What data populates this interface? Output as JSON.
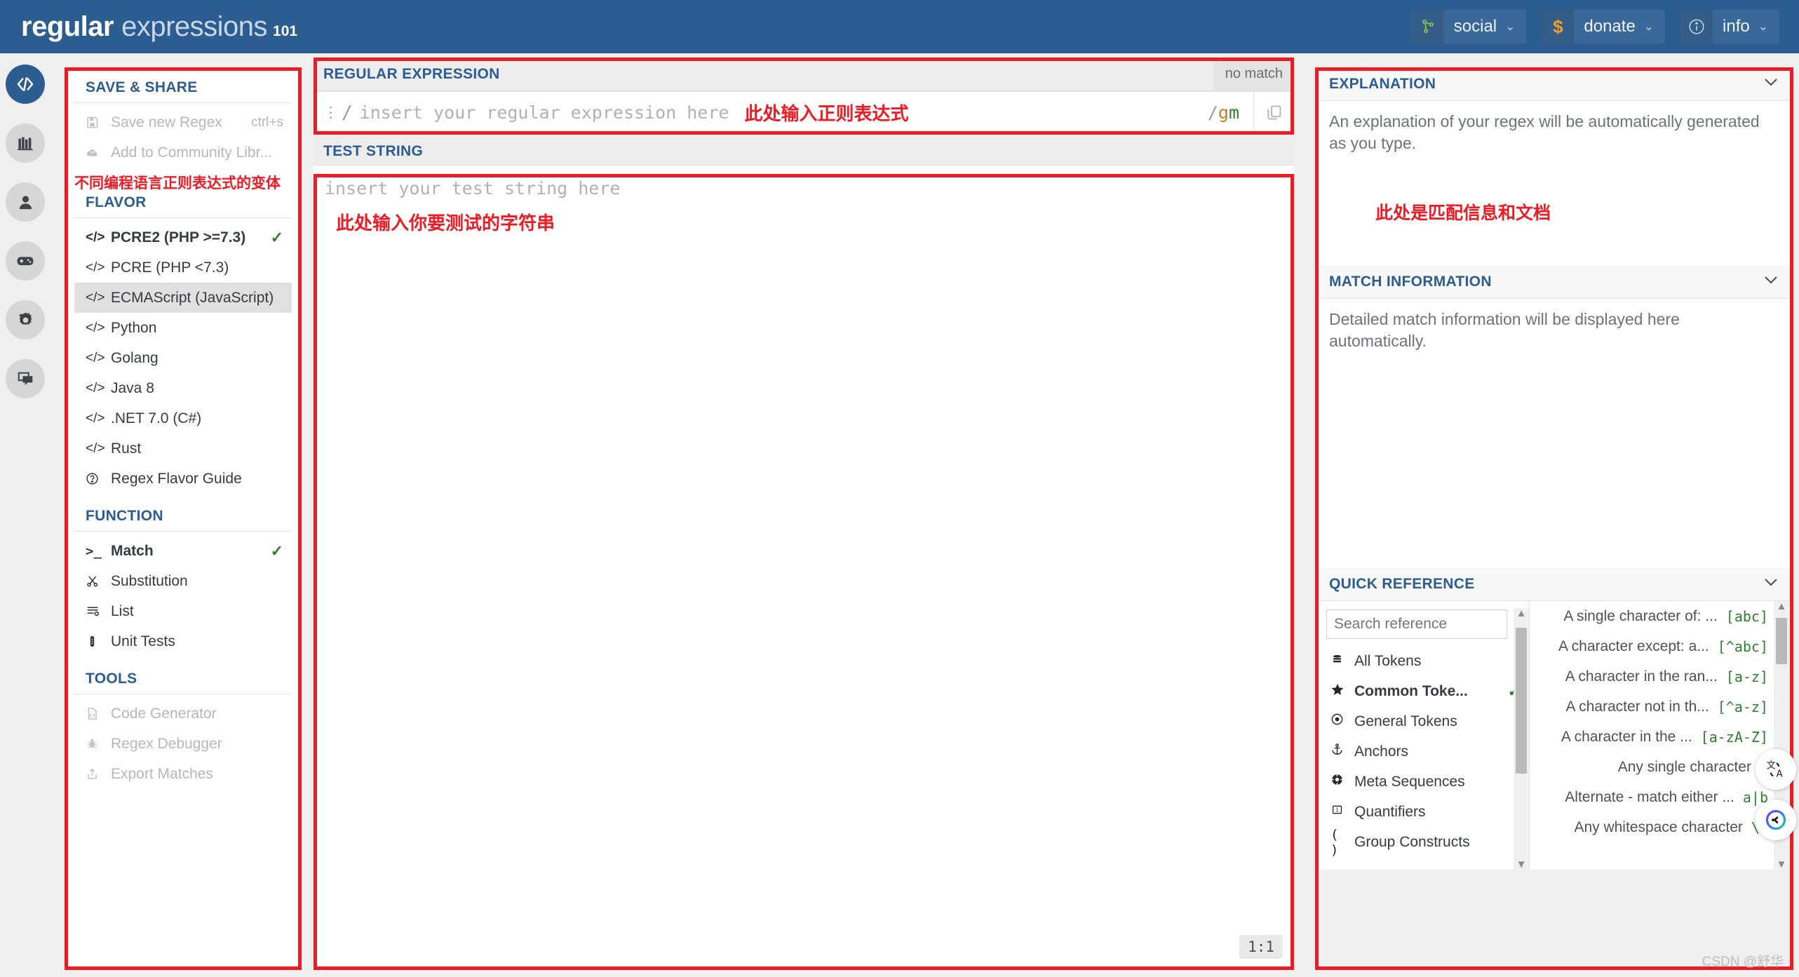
{
  "header": {
    "logo": {
      "part1": "regular",
      "part2": "expressions",
      "part3": "101"
    },
    "nav": [
      {
        "icon": "share-nodes-icon",
        "glyph": "⑂",
        "label": "social",
        "caret": "⌄"
      },
      {
        "icon": "dollar-icon",
        "glyph": "$",
        "label": "donate",
        "caret": "⌄"
      },
      {
        "icon": "info-circle-icon",
        "glyph": "ⓘ",
        "label": "info",
        "caret": "⌄"
      }
    ]
  },
  "rail": [
    {
      "name": "code-icon",
      "glyph": "</>",
      "active": true
    },
    {
      "name": "library-icon",
      "glyph": "📚",
      "active": false
    },
    {
      "name": "account-icon",
      "glyph": "👤",
      "active": false
    },
    {
      "name": "gamepad-icon",
      "glyph": "🎮",
      "active": false
    },
    {
      "name": "settings-gear-icon",
      "glyph": "⚙",
      "active": false
    },
    {
      "name": "forum-chat-icon",
      "glyph": "🗩",
      "active": false
    }
  ],
  "sidebar": {
    "save_share": {
      "heading": "SAVE & SHARE",
      "items": [
        {
          "icon": "save-icon",
          "glyph": "💾",
          "label": "Save new Regex",
          "shortcut": "ctrl+s",
          "disabled": true
        },
        {
          "icon": "cloud-upload-icon",
          "glyph": "☁",
          "label": "Add to Community Libr...",
          "shortcut": "",
          "disabled": true
        }
      ]
    },
    "annotation_flavor": "不同编程语言正则表达式的变体",
    "flavor": {
      "heading": "FLAVOR",
      "items": [
        {
          "icon": "code-icon",
          "glyph": "</>",
          "label": "PCRE2 (PHP >=7.3)",
          "selected": true,
          "checked": true
        },
        {
          "icon": "code-icon",
          "glyph": "</>",
          "label": "PCRE (PHP <7.3)",
          "selected": false,
          "checked": false
        },
        {
          "icon": "code-icon",
          "glyph": "</>",
          "label": "ECMAScript (JavaScript)",
          "selected": true,
          "checked": false
        },
        {
          "icon": "code-icon",
          "glyph": "</>",
          "label": "Python",
          "selected": false,
          "checked": false
        },
        {
          "icon": "code-icon",
          "glyph": "</>",
          "label": "Golang",
          "selected": false,
          "checked": false
        },
        {
          "icon": "code-icon",
          "glyph": "</>",
          "label": "Java 8",
          "selected": false,
          "checked": false
        },
        {
          "icon": "code-icon",
          "glyph": "</>",
          "label": ".NET 7.0 (C#)",
          "selected": false,
          "checked": false
        },
        {
          "icon": "code-icon",
          "glyph": "</>",
          "label": "Rust",
          "selected": false,
          "checked": false
        },
        {
          "icon": "help-circle-icon",
          "glyph": "?",
          "label": "Regex Flavor Guide",
          "selected": false,
          "checked": false
        }
      ]
    },
    "function": {
      "heading": "FUNCTION",
      "items": [
        {
          "icon": "terminal-icon",
          "glyph": ">_",
          "label": "Match",
          "bold": true,
          "checked": true
        },
        {
          "icon": "scissors-icon",
          "glyph": "✂",
          "label": "Substitution",
          "bold": false,
          "checked": false
        },
        {
          "icon": "list-icon",
          "glyph": "≣",
          "label": "List",
          "bold": false,
          "checked": false
        },
        {
          "icon": "test-tube-icon",
          "glyph": "🧪",
          "label": "Unit Tests",
          "bold": false,
          "checked": false
        }
      ]
    },
    "tools": {
      "heading": "TOOLS",
      "items": [
        {
          "icon": "file-code-icon",
          "glyph": "📄",
          "label": "Code Generator",
          "disabled": true
        },
        {
          "icon": "bug-icon",
          "glyph": "🐛",
          "label": "Regex Debugger",
          "disabled": true
        },
        {
          "icon": "export-icon",
          "glyph": "⇧",
          "label": "Export Matches",
          "disabled": true
        }
      ]
    }
  },
  "regex_panel": {
    "title": "REGULAR EXPRESSION",
    "status": "no match",
    "drag_handle_icon": "drag-dots-icon",
    "open_delimiter": "/",
    "placeholder": "insert your regular expression here",
    "annotation": "此处输入正则表达式",
    "close_delimiter": "/",
    "flags": "gm",
    "flag_g": "g",
    "flag_m": "m",
    "copy_icon": "copy-icon"
  },
  "test_string_panel": {
    "title": "TEST STRING",
    "placeholder": "insert your test string here",
    "annotation": "此处输入你要测试的字符串",
    "cursor_position": "1:1"
  },
  "explanation_panel": {
    "title": "EXPLANATION",
    "body": "An explanation of your regex will be automatically generated as you type.",
    "annotation": "此处是匹配信息和文档",
    "collapse_icon": "chevron-down-icon"
  },
  "match_info_panel": {
    "title": "MATCH INFORMATION",
    "body": "Detailed match information will be displayed here automatically.",
    "collapse_icon": "chevron-down-icon"
  },
  "quick_reference": {
    "title": "QUICK REFERENCE",
    "collapse_icon": "chevron-down-icon",
    "search_placeholder": "Search reference",
    "categories": [
      {
        "icon": "tokens-stack-icon",
        "glyph": "▤",
        "label": "All Tokens",
        "bold": false,
        "checked": false
      },
      {
        "icon": "star-icon",
        "glyph": "★",
        "label": "Common Toke...",
        "bold": true,
        "checked": true
      },
      {
        "icon": "target-dot-icon",
        "glyph": "⊙",
        "label": "General Tokens",
        "bold": false,
        "checked": false
      },
      {
        "icon": "anchor-icon",
        "glyph": "⚓",
        "label": "Anchors",
        "bold": false,
        "checked": false
      },
      {
        "icon": "meta-sequence-icon",
        "glyph": "✸",
        "label": "Meta Sequences",
        "bold": false,
        "checked": false
      },
      {
        "icon": "quantifier-icon",
        "glyph": "⧉",
        "label": "Quantifiers",
        "bold": false,
        "checked": false
      },
      {
        "icon": "parens-icon",
        "glyph": "( )",
        "label": "Group Constructs",
        "bold": false,
        "checked": false
      }
    ],
    "tokens": [
      {
        "description": "A single character of: ...",
        "token": "[abc]"
      },
      {
        "description": "A character except: a...",
        "token": "[^abc]"
      },
      {
        "description": "A character in the ran...",
        "token": "[a-z]"
      },
      {
        "description": "A character not in th...",
        "token": "[^a-z]"
      },
      {
        "description": "A character in the ...",
        "token": "[a-zA-Z]"
      },
      {
        "description": "Any single character",
        "token": "."
      },
      {
        "description": "Alternate - match either ...",
        "token": "a|b"
      },
      {
        "description": "Any whitespace character",
        "token": "\\s"
      }
    ]
  },
  "floating": [
    {
      "name": "translate-icon",
      "glyph": "文A"
    },
    {
      "name": "assistant-avatar-icon",
      "glyph": "◑"
    }
  ],
  "watermark": "CSDN @舒华",
  "colors": {
    "brand": "#2c5d91",
    "annotation_red": "#ee1b24",
    "check_green": "#2e7d32",
    "token_green": "#2e7d32"
  }
}
